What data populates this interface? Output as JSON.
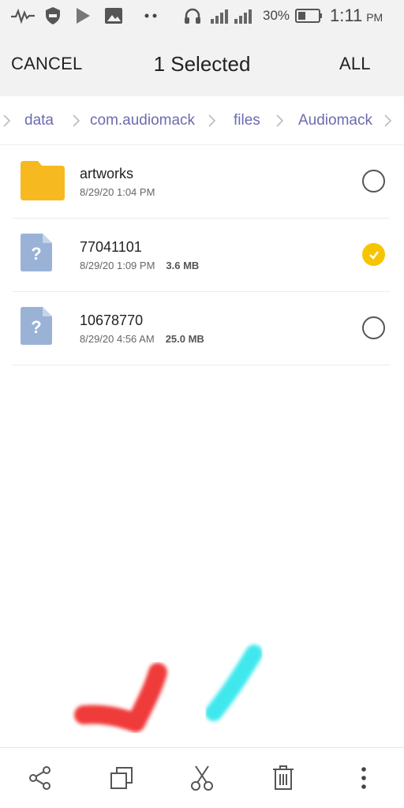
{
  "status_bar": {
    "battery_percent": "30%",
    "time": "1:11",
    "ampm": "PM",
    "icons": [
      "signal-wave-icon",
      "shield-icon",
      "play-store-icon",
      "image-icon",
      "dots-icon",
      "headphones-icon",
      "cell-signal-icon",
      "cell-signal-icon",
      "battery-icon"
    ]
  },
  "header": {
    "cancel_label": "CANCEL",
    "title": "1 Selected",
    "all_label": "ALL"
  },
  "breadcrumb": {
    "items": [
      "data",
      "com.audiomack",
      "files",
      "Audiomack"
    ]
  },
  "files": [
    {
      "name": "artworks",
      "date": "8/29/20 1:04 PM",
      "size": "",
      "type": "folder",
      "selected": false
    },
    {
      "name": "77041101",
      "date": "8/29/20 1:09 PM",
      "size": "3.6 MB",
      "type": "unknown",
      "selected": true
    },
    {
      "name": "10678770",
      "date": "8/29/20 4:56 AM",
      "size": "25.0 MB",
      "type": "unknown",
      "selected": false
    }
  ],
  "toolbar": {
    "actions": [
      "share-icon",
      "copy-icon",
      "cut-icon",
      "delete-icon",
      "more-icon"
    ]
  },
  "colors": {
    "accent": "#f6c500",
    "folder": "#f6b91f",
    "file_icon": "#9ab2d6",
    "breadcrumb": "#6b6bb0",
    "stroke_red": "#f03a3a",
    "stroke_cyan": "#3fe8ee"
  }
}
